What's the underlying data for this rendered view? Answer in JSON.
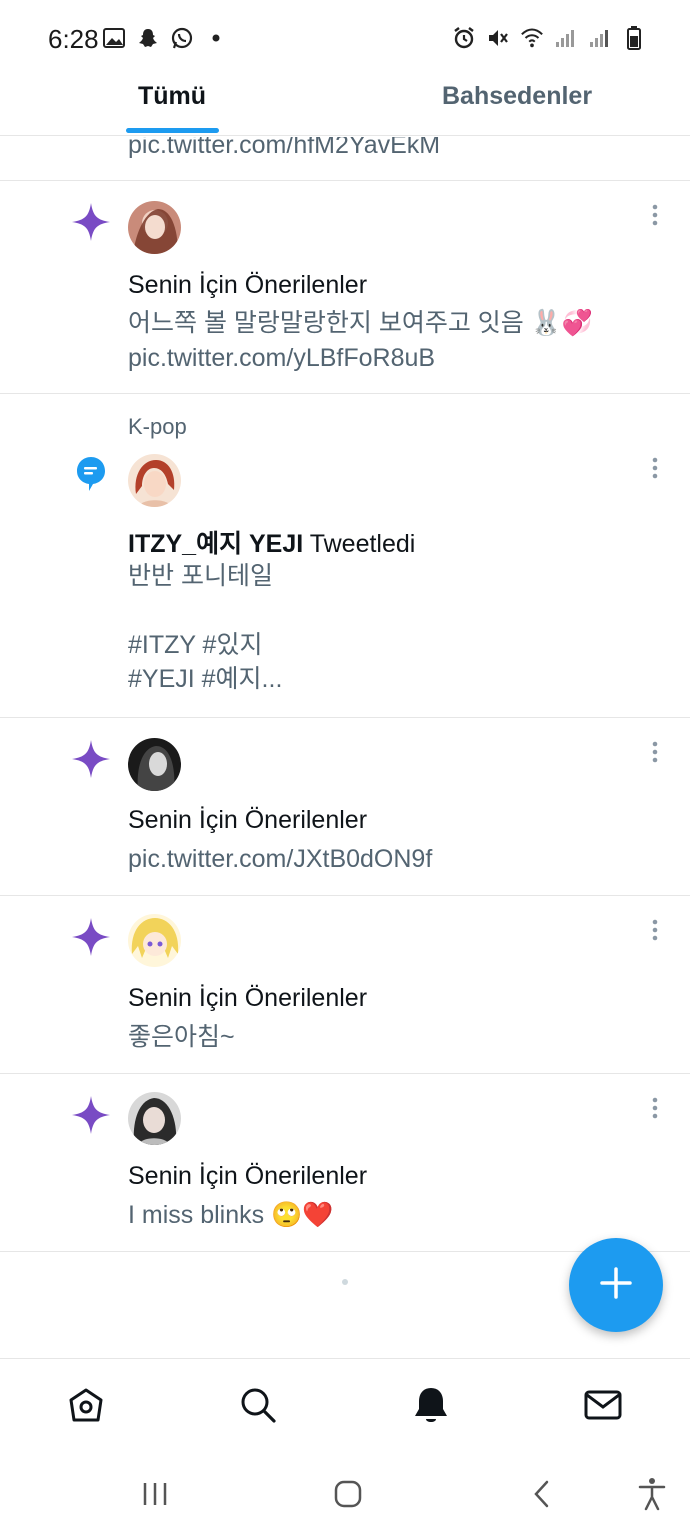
{
  "status_bar": {
    "time": "6:28"
  },
  "tabs": [
    {
      "label": "Tümü",
      "active": true
    },
    {
      "label": "Bahsedenler",
      "active": false
    }
  ],
  "feed": {
    "cut_off_link": "pic.twitter.com/hfM2YavEkM",
    "notifications": [
      {
        "kind": "star",
        "title": "Senin İçin Önerilenler",
        "body_lines": [
          "어느쪽 볼 말랑말랑한지 보여주고 잇음 🐰💞",
          "pic.twitter.com/yLBfFoR8uB"
        ]
      },
      {
        "kind": "tweet",
        "context": "K-pop",
        "author": "ITZY_예지 YEJI",
        "action": " Tweetledi",
        "body_lines": [
          "반반 포니테일",
          "",
          "#ITZY #있지",
          "#YEJI #예지..."
        ]
      },
      {
        "kind": "star",
        "title": "Senin İçin Önerilenler",
        "body_lines": [
          "pic.twitter.com/JXtB0dON9f"
        ]
      },
      {
        "kind": "star",
        "title": "Senin İçin Önerilenler",
        "body_lines": [
          "좋은아침~"
        ]
      },
      {
        "kind": "star",
        "title": "Senin İçin Önerilenler",
        "body_lines": [
          "I miss blinks 🙄❤️"
        ]
      }
    ]
  },
  "colors": {
    "accent": "#1d9bf0",
    "star": "#794bc4",
    "muted_text": "#536471"
  },
  "icons": {
    "fab": "plus-icon",
    "nav": [
      "home-icon",
      "search-icon",
      "bell-icon",
      "mail-icon"
    ],
    "system": [
      "recents-icon",
      "home-circle-icon",
      "back-icon",
      "accessibility-icon"
    ]
  }
}
